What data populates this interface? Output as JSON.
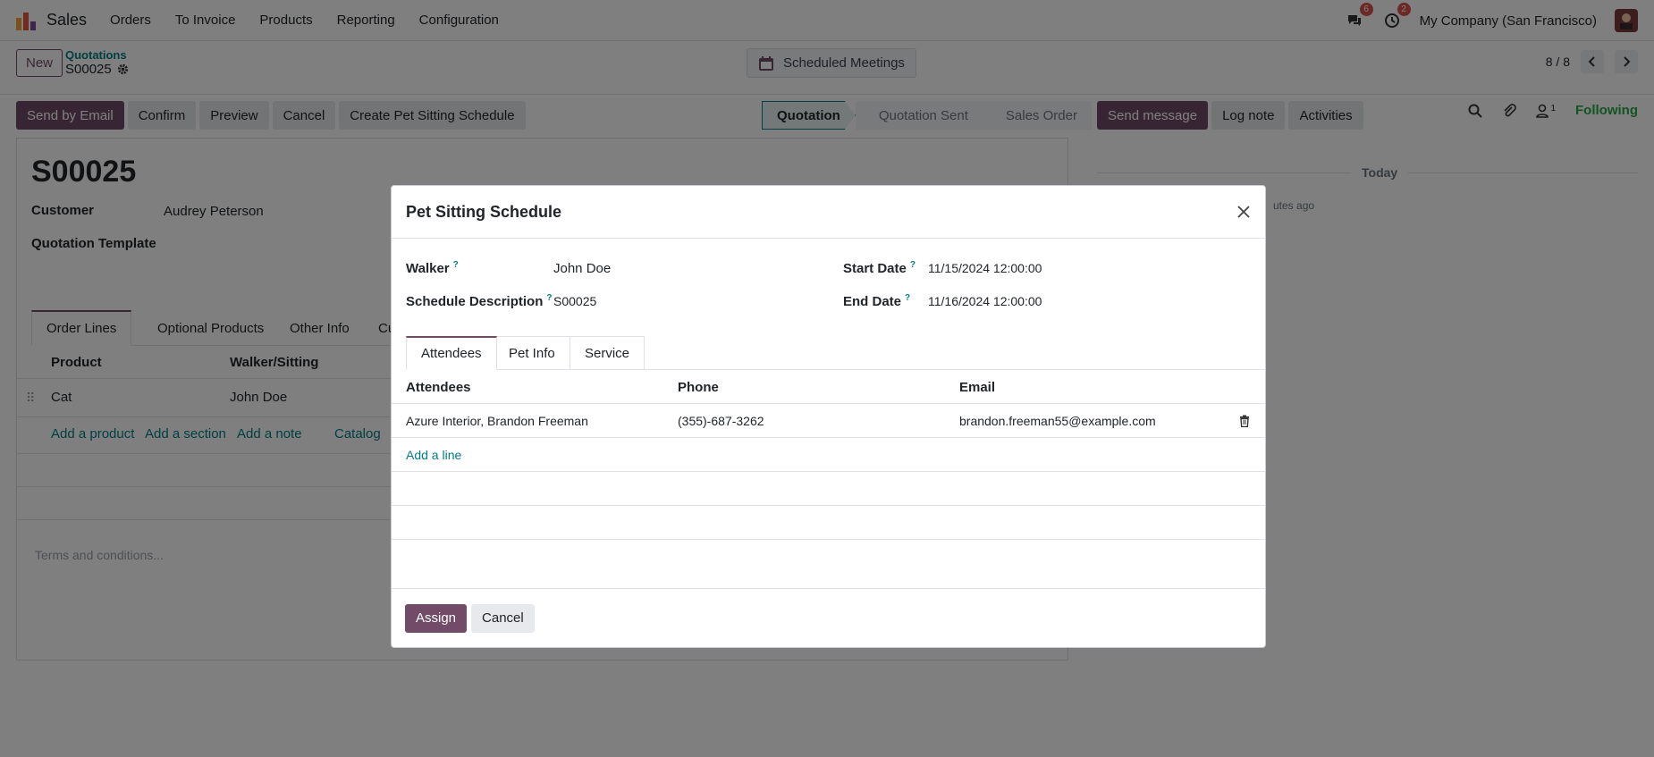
{
  "navbar": {
    "app_name": "Sales",
    "menu": [
      "Orders",
      "To Invoice",
      "Products",
      "Reporting",
      "Configuration"
    ],
    "messages_count": "6",
    "activities_count": "2",
    "company": "My Company (San Francisco)"
  },
  "control_panel": {
    "new_label": "New",
    "breadcrumb_parent": "Quotations",
    "breadcrumb_current": "S00025",
    "scheduled_meetings": "Scheduled Meetings",
    "pager": "8 / 8"
  },
  "actions": {
    "send_by_email": "Send by Email",
    "confirm": "Confirm",
    "preview": "Preview",
    "cancel": "Cancel",
    "create_schedule": "Create Pet Sitting Schedule"
  },
  "status_stages": [
    "Quotation",
    "Quotation Sent",
    "Sales Order"
  ],
  "form": {
    "title": "S00025",
    "customer_label": "Customer",
    "customer_value": "Audrey Peterson",
    "template_label": "Quotation Template",
    "tabs": [
      "Order Lines",
      "Optional Products",
      "Other Info",
      "Cust"
    ],
    "col_product": "Product",
    "col_walker": "Walker/Sitting",
    "line_product": "Cat",
    "line_walker": "John Doe",
    "add_product": "Add a product",
    "add_section": "Add a section",
    "add_note": "Add a note",
    "catalog": "Catalog",
    "terms_placeholder": "Terms and conditions..."
  },
  "chatter": {
    "send_message": "Send message",
    "log_note": "Log note",
    "activities": "Activities",
    "followers_count": "1",
    "following": "Following",
    "today": "Today",
    "time_ago": "utes ago"
  },
  "modal": {
    "title": "Pet Sitting Schedule",
    "walker_label": "Walker",
    "walker_value": "John Doe",
    "desc_label": "Schedule Description",
    "desc_value": "S00025",
    "start_label": "Start Date",
    "start_value": "11/15/2024 12:00:00",
    "end_label": "End Date",
    "end_value": "11/16/2024 12:00:00",
    "help_mark": "?",
    "tabs": [
      "Attendees",
      "Pet Info",
      "Service"
    ],
    "columns": [
      "Attendees",
      "Phone",
      "Email"
    ],
    "rows": [
      {
        "attendees": "Azure Interior, Brandon Freeman",
        "phone": "(355)-687-3262",
        "email": "brandon.freeman55@example.com"
      }
    ],
    "add_line": "Add a line",
    "assign": "Assign",
    "cancel": "Cancel"
  },
  "colors": {
    "brand": "#714B67",
    "link": "#017e84",
    "following": "#28a745"
  }
}
